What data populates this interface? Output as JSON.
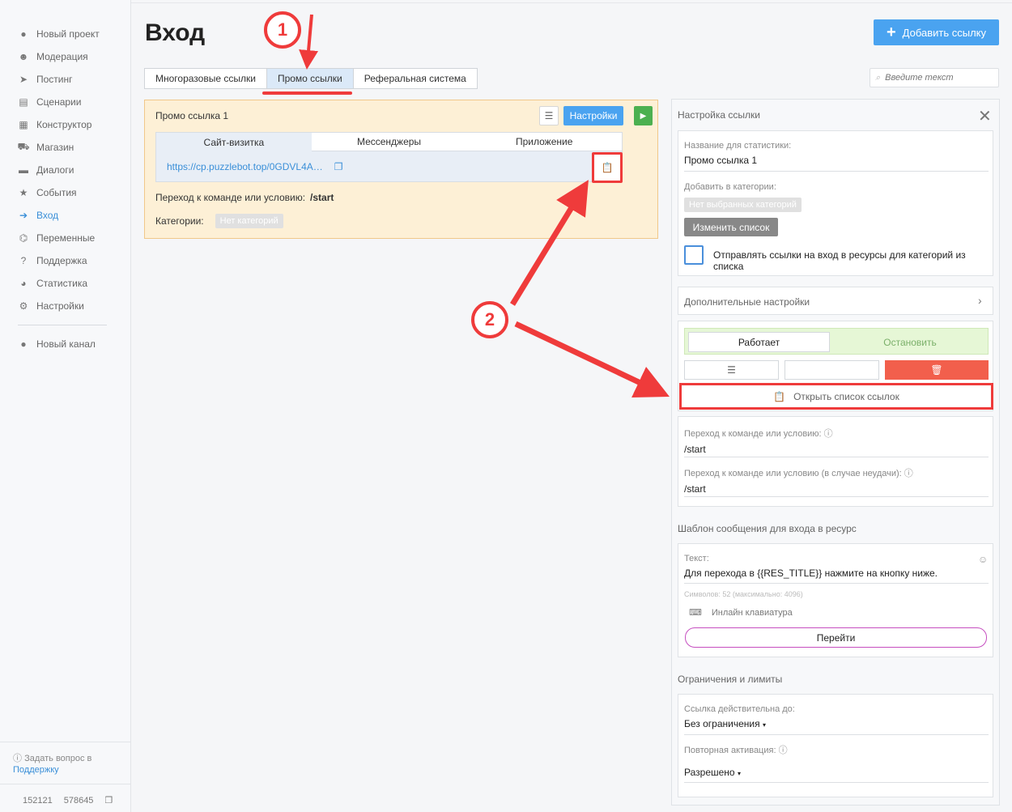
{
  "sidebar": {
    "items": [
      {
        "label": "Новый проект",
        "icon": "project-icon"
      },
      {
        "label": "Модерация",
        "icon": "users-icon"
      },
      {
        "label": "Постинг",
        "icon": "paper-plane-icon"
      },
      {
        "label": "Сценарии",
        "icon": "scenarios-icon"
      },
      {
        "label": "Конструктор",
        "icon": "grid-icon"
      },
      {
        "label": "Магазин",
        "icon": "cart-icon"
      },
      {
        "label": "Диалоги",
        "icon": "chat-icon"
      },
      {
        "label": "События",
        "icon": "star-icon"
      },
      {
        "label": "Вход",
        "icon": "sign-in-icon",
        "active": true
      },
      {
        "label": "Переменные",
        "icon": "variables-icon"
      },
      {
        "label": "Поддержка",
        "icon": "question-icon"
      },
      {
        "label": "Статистика",
        "icon": "pie-chart-icon"
      },
      {
        "label": "Настройки",
        "icon": "gear-icon"
      }
    ],
    "channel": "Новый канал",
    "help_text": "Задать вопрос в",
    "help_link": "Поддержку",
    "id_a": "152121",
    "id_b": "578645"
  },
  "header": {
    "title": "Вход",
    "add_button": "Добавить ссылку",
    "search_placeholder": "Введите текст"
  },
  "tabs": [
    "Многоразовые ссылки",
    "Промо ссылки",
    "Реферальная система"
  ],
  "promo": {
    "title": "Промо ссылка 1",
    "settings_button": "Настройки",
    "inner_tabs": [
      "Сайт-визитка",
      "Мессенджеры",
      "Приложение"
    ],
    "link": "https://cp.puzzlebot.top/0GDVL4A…",
    "command_label": "Переход к команде или условию:",
    "command_value": "/start",
    "categories_label": "Категории:",
    "categories_value": "Нет категорий"
  },
  "panel": {
    "title": "Настройка ссылки",
    "stat_name_label": "Название для статистики:",
    "stat_name_value": "Промо ссылка 1",
    "add_category_label": "Добавить в категории:",
    "no_categories": "Нет выбранных категорий",
    "change_list": "Изменить список",
    "send_links_label": "Отправлять ссылки на вход в ресурсы для категорий из списка",
    "advanced": "Дополнительные настройки",
    "status_on": "Работает",
    "status_off": "Остановить",
    "open_list": "Открыть список ссылок",
    "cmd_label": "Переход к команде или условию:",
    "cmd_value": "/start",
    "cmd_fail_label": "Переход к команде или условию (в случае неудачи):",
    "cmd_fail_value": "/start",
    "template_title": "Шаблон сообщения для входа в ресурс",
    "text_label": "Текст:",
    "text_value": "Для перехода в {{RES_TITLE}} нажмите на кнопку ниже.",
    "chars": "Символов: 52 (максимально: 4096)",
    "inline_kb": "Инлайн клавиатура",
    "go_button": "Перейти",
    "limits_title": "Ограничения и лимиты",
    "valid_until_label": "Ссылка действительна до:",
    "valid_until_value": "Без ограничения",
    "reactivation_label": "Повторная активация:",
    "reactivation_value": "Разрешено"
  },
  "annotations": {
    "marker1": "1",
    "marker2": "2"
  },
  "colors": {
    "accent": "#4aa3f0",
    "annotation": "#ef3b3b",
    "play": "#4cb050",
    "delete": "#f25f4c"
  }
}
